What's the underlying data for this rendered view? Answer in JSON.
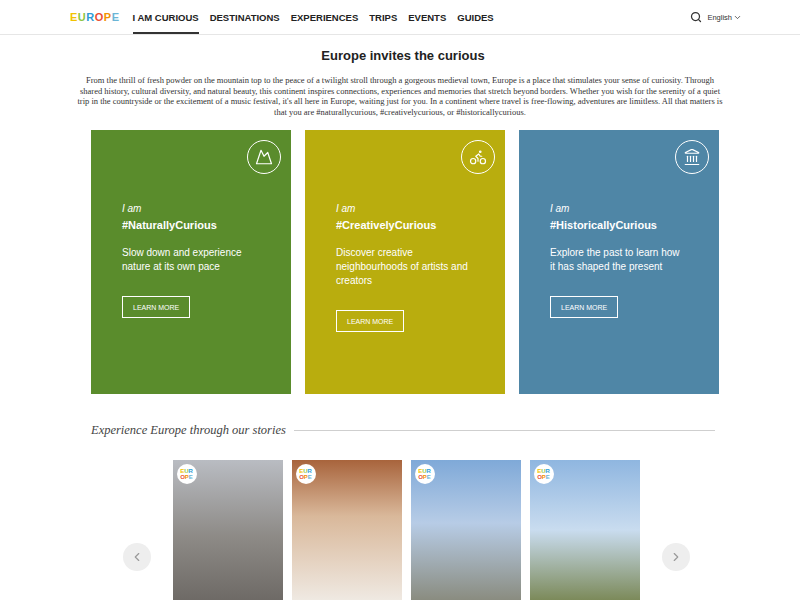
{
  "logo": {
    "letters": [
      {
        "char": "E",
        "color": "#f2c200"
      },
      {
        "char": "U",
        "color": "#8cc63f"
      },
      {
        "char": "R",
        "color": "#2e9cd6"
      },
      {
        "char": "O",
        "color": "#e94f35"
      },
      {
        "char": "P",
        "color": "#f39200"
      },
      {
        "char": "E",
        "color": "#6bb5d6"
      }
    ]
  },
  "nav": {
    "items": [
      {
        "label": "I AM CURIOUS",
        "selected": true
      },
      {
        "label": "DESTINATIONS",
        "selected": false
      },
      {
        "label": "EXPERIENCES",
        "selected": false
      },
      {
        "label": "TRIPS",
        "selected": false
      },
      {
        "label": "EVENTS",
        "selected": false
      },
      {
        "label": "GUIDES",
        "selected": false
      }
    ]
  },
  "language": {
    "label": "English"
  },
  "intro": {
    "title": "Europe invites the curious",
    "text": "From the thrill of fresh powder on the mountain top to the peace of a twilight stroll through a gorgeous medieval town, Europe is a place that stimulates your sense of curiosity. Through shared history, cultural diversity, and natural beauty, this continent inspires connections, experiences and memories that stretch beyond borders. Whether you wish for the serenity of a quiet trip in the countryside or the excitement of a music festival, it's all here in Europe, waiting just for you. In a continent where travel is free-flowing, adventures are limitless. All that matters is that you are #naturallycurious, #creativelycurious, or #historicallycurious."
  },
  "cards": [
    {
      "lead": "I am",
      "tag": "#NaturallyCurious",
      "description": "Slow down and experience nature at its own pace",
      "button": "LEARN MORE",
      "color": "#5a8c2c"
    },
    {
      "lead": "I am",
      "tag": "#CreativelyCurious",
      "description": "Discover creative neighbourhoods of artists and creators",
      "button": "LEARN MORE",
      "color": "#b9ad0e"
    },
    {
      "lead": "I am",
      "tag": "#HistoricallyCurious",
      "description": "Explore the past to learn how it has shaped the present",
      "button": "LEARN MORE",
      "color": "#4f86a6"
    }
  ],
  "stories": {
    "title": "Experience Europe through our stories",
    "items": [
      {
        "badge": [
          "EUR",
          "OPE"
        ]
      },
      {
        "badge": [
          "EUR",
          "OPE"
        ]
      },
      {
        "badge": [
          "EUR",
          "OPE"
        ]
      },
      {
        "badge": [
          "EUR",
          "OPE"
        ]
      }
    ]
  }
}
